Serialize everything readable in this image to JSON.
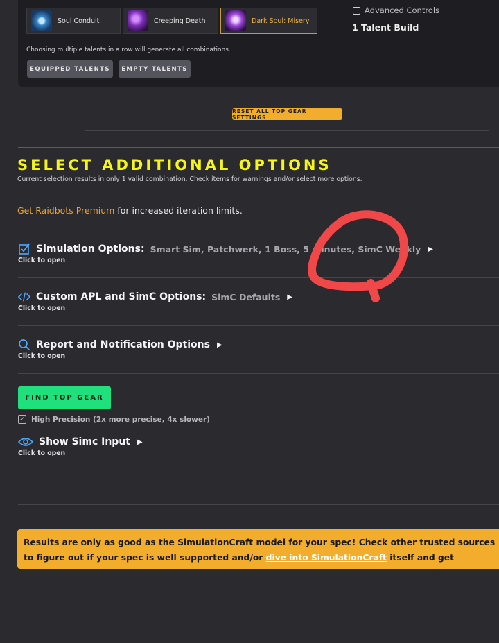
{
  "talents": {
    "items": [
      {
        "name": "Soul Conduit",
        "icon": "soul-conduit-icon",
        "selected": false
      },
      {
        "name": "Creeping Death",
        "icon": "creeping-death-icon",
        "selected": false
      },
      {
        "name": "Dark Soul: Misery",
        "icon": "dark-soul-misery-icon",
        "selected": true
      }
    ],
    "hint": "Choosing multiple talents in a row will generate all combinations.",
    "equipped_button": "EQUIPPED TALENTS",
    "empty_button": "EMPTY TALENTS",
    "advanced_controls": "Advanced Controls",
    "build_count": "1 Talent Build"
  },
  "reset_button": "RESET ALL TOP GEAR SETTINGS",
  "additional": {
    "title": "SELECT ADDITIONAL OPTIONS",
    "subtitle": "Current selection results in only 1 valid combination. Check items for warnings and/or select more options.",
    "premium_link": "Get Raidbots Premium",
    "premium_text": " for increased iteration limits."
  },
  "options": [
    {
      "icon": "checkbox-icon",
      "title": "Simulation Options:",
      "value": "Smart Sim, Patchwerk, 1 Boss, 5 minutes, SimC Weekly",
      "hint": "Click to open"
    },
    {
      "icon": "code-icon",
      "title": "Custom APL and SimC Options:",
      "value": "SimC Defaults",
      "hint": "Click to open"
    },
    {
      "icon": "search-icon",
      "title": "Report and Notification Options",
      "value": "",
      "hint": "Click to open"
    }
  ],
  "find_button": "FIND TOP GEAR",
  "high_precision": "High Precision (2x more precise, 4x slower)",
  "show_simc": {
    "title": "Show Simc Input",
    "hint": "Click to open",
    "icon": "eye-icon"
  },
  "warning": {
    "text_before": "Results are only as good as the SimulationCraft model for your spec! Check other trusted sources to figure out if your spec is well supported and/or ",
    "link": "dive into SimulationCraft",
    "text_after": " itself and get involved!"
  },
  "colors": {
    "accent_yellow": "#f5f51a",
    "gold": "#f2ad2d",
    "green": "#1fe07c",
    "annotation_red": "#f04848"
  }
}
